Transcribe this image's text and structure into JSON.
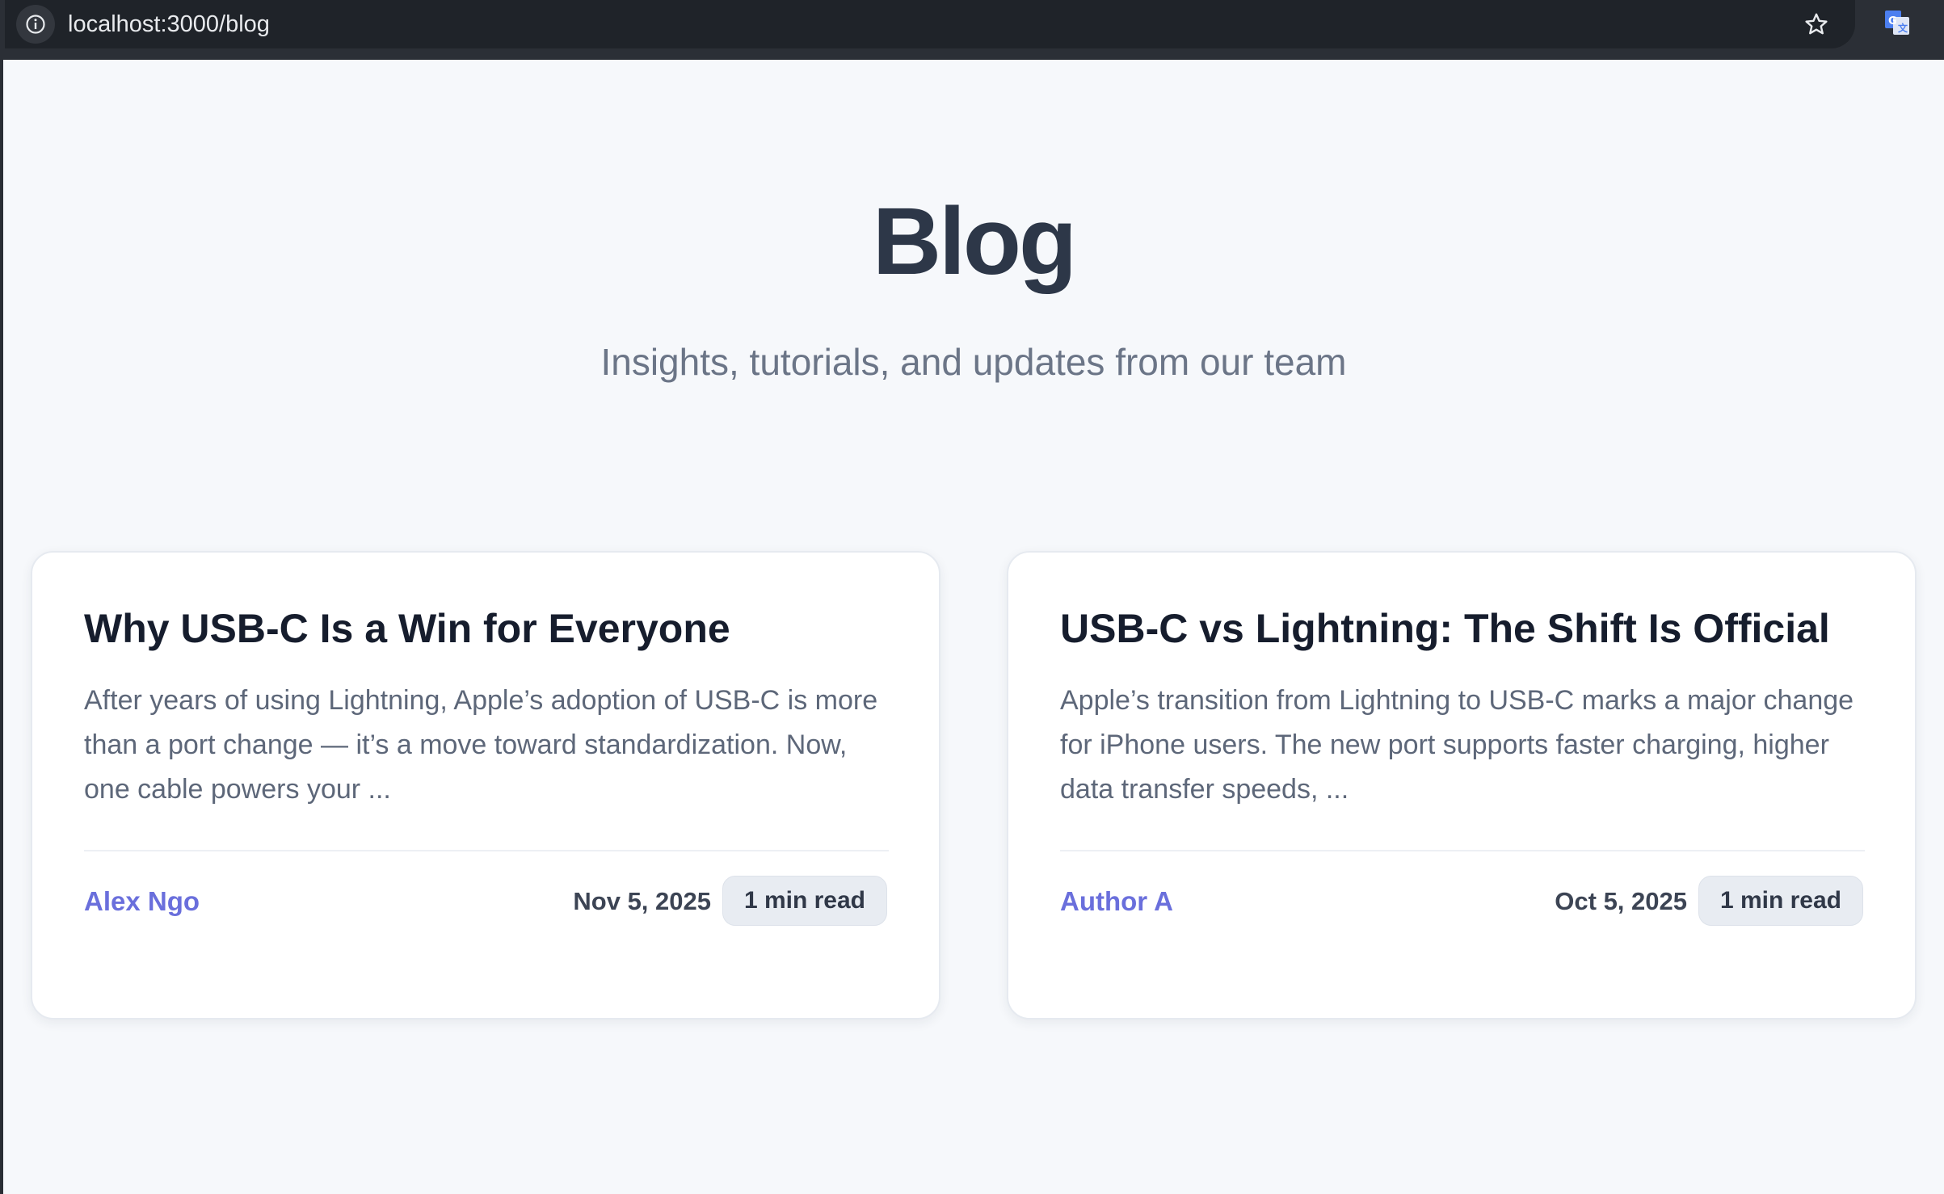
{
  "browser": {
    "url": "localhost:3000/blog",
    "info_icon": "info-icon",
    "star_icon": "star-icon",
    "translate_icon": "google-translate-icon"
  },
  "header": {
    "title": "Blog",
    "subtitle": "Insights, tutorials, and updates from our team"
  },
  "posts": [
    {
      "title": "Why USB-C Is a Win for Everyone",
      "excerpt": "After years of using Lightning, Apple’s adoption of USB-C is more than a port change — it’s a move toward standardization. Now, one cable powers your ...",
      "author": "Alex Ngo",
      "date": "Nov 5, 2025",
      "read_time": "1 min read"
    },
    {
      "title": "USB-C vs Lightning: The Shift Is Official",
      "excerpt": "Apple’s transition from Lightning to USB-C marks a major change for iPhone users. The new port supports faster charging, higher data transfer speeds, ...",
      "author": "Author A",
      "date": "Oct 5, 2025",
      "read_time": "1 min read"
    }
  ],
  "colors": {
    "accent": "#6a6fdc",
    "page_background": "#f6f8fb",
    "heading": "#2d3748"
  }
}
